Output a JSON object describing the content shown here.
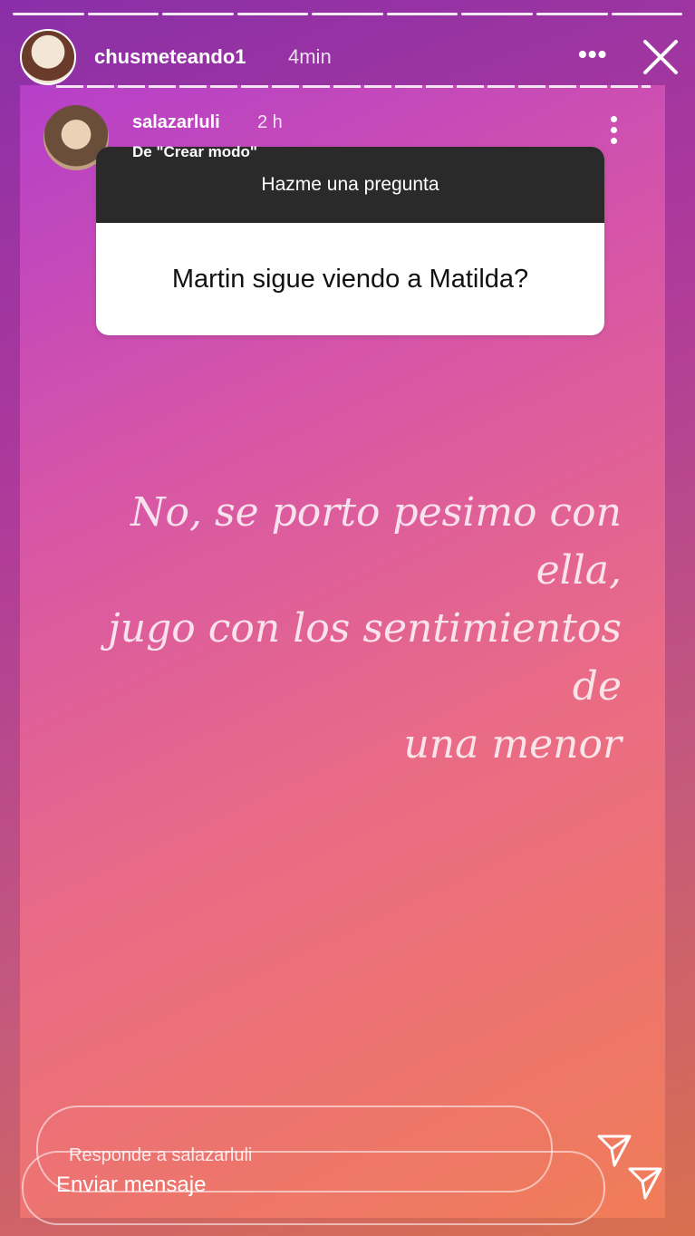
{
  "story": {
    "progress_segments": 9,
    "user": "chusmeteando1",
    "time": "4min"
  },
  "inner_story": {
    "user": "salazarluli",
    "time": "2 h",
    "from_label": "De \"Crear modo\""
  },
  "question": {
    "header": "Hazme una pregunta",
    "text": "Martin sigue viendo a Matilda?"
  },
  "answer": {
    "line1": "No, se porto pesimo con ella,",
    "line2": "jugo con los sentimientos de",
    "line3": "una menor"
  },
  "reply": {
    "inner_placeholder": "Responde a salazarluli",
    "message_placeholder": "Enviar mensaje"
  },
  "icons": {
    "more": "more-dots-icon",
    "close": "close-icon",
    "send": "send-icon"
  }
}
